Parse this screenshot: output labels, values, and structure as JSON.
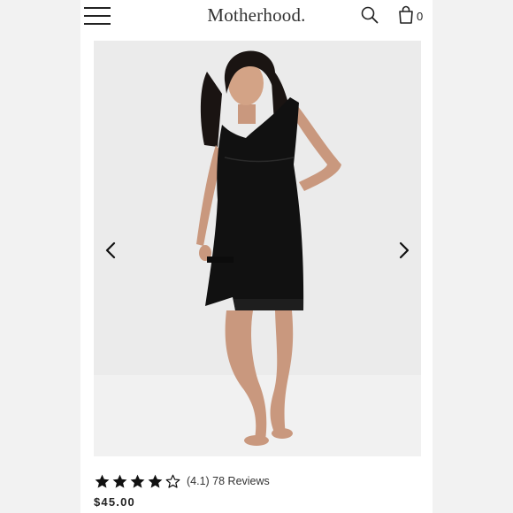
{
  "header": {
    "brand": "Motherhood.",
    "cart_count": "0",
    "icons": [
      "menu-icon",
      "search-icon",
      "shopping-bag-icon"
    ]
  },
  "gallery": {
    "prev_icon": "chevron-left-icon",
    "next_icon": "chevron-right-icon"
  },
  "product": {
    "rating_value": 4.1,
    "rating_max": 5,
    "rating_text": "(4.1) 78 Reviews",
    "price": "$45.00"
  },
  "colors": {
    "page_bg": "#f2f2f2",
    "image_bg": "#ebebeb",
    "dress": "#111111",
    "text": "#222222"
  }
}
